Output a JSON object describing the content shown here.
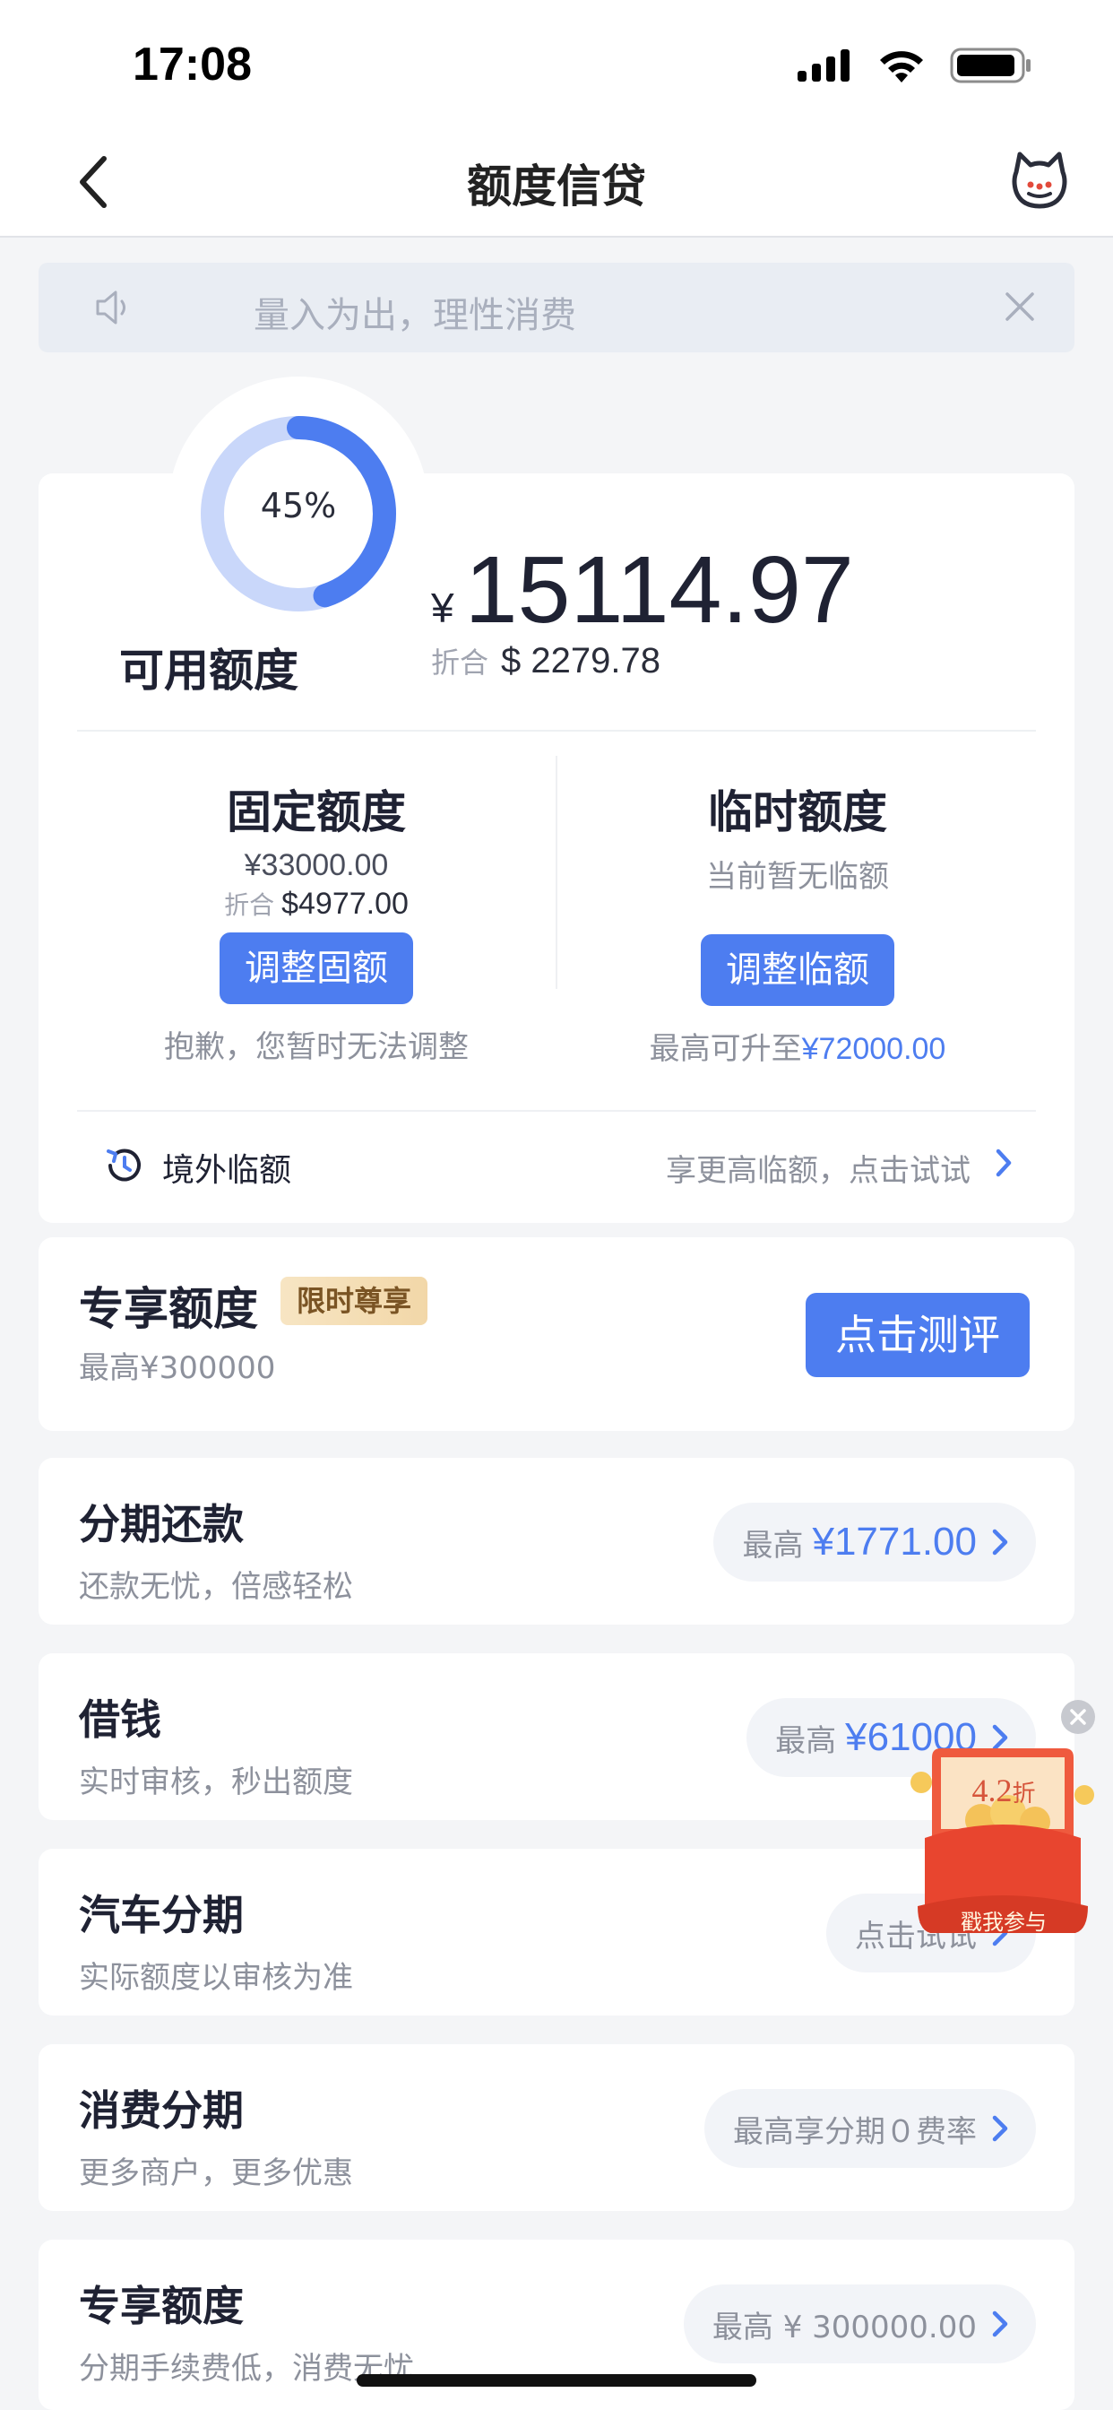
{
  "status_bar": {
    "time": "17:08"
  },
  "nav": {
    "title": "额度信贷"
  },
  "notice": {
    "text": "量入为出，理性消费"
  },
  "credit": {
    "percent_label": "45%",
    "percent_value": 0.45,
    "available_label": "可用额度",
    "currency": "¥",
    "available_amount": "15114.97",
    "usd_prefix": "折合",
    "usd_amount": "$ 2279.78",
    "fixed": {
      "title": "固定额度",
      "cny": "¥33000.00",
      "usd_prefix": "折合",
      "usd": "$4977.00",
      "button": "调整固额",
      "note": "抱歉，您暂时无法调整"
    },
    "temp": {
      "title": "临时额度",
      "status": "当前暂无临额",
      "button": "调整临额",
      "note_prefix": "最高可升至",
      "note_amount": "¥72000.00"
    },
    "overseas": {
      "label": "境外临额",
      "hint": "享更高临额，点击试试"
    }
  },
  "exclusive": {
    "title": "专享额度",
    "badge": "限时尊享",
    "sub": "最高¥300000",
    "button": "点击测评"
  },
  "services": [
    {
      "title": "分期还款",
      "sub": "还款无忧，倍感轻松",
      "pill_prefix": "最高",
      "pill_amount": "¥1771.00"
    },
    {
      "title": "借钱",
      "sub": "实时审核，秒出额度",
      "pill_prefix": "最高",
      "pill_amount": "¥61000"
    },
    {
      "title": "汽车分期",
      "sub": "实际额度以审核为准",
      "pill_text": "点击试试"
    },
    {
      "title": "消费分期",
      "sub": "更多商户，更多优惠",
      "pill_text": "最高享分期０费率"
    },
    {
      "title": "专享额度",
      "sub": "分期手续费低，消费无忧",
      "pill_text": "最高 ¥ 300000.00"
    }
  ],
  "promo": {
    "discount": "4.2",
    "discount_unit": "折",
    "cta": "戳我参与"
  },
  "colors": {
    "accent": "#4d7df0",
    "donut_track": "#c9d7fa",
    "badge_bg": "#f2d7a8"
  }
}
